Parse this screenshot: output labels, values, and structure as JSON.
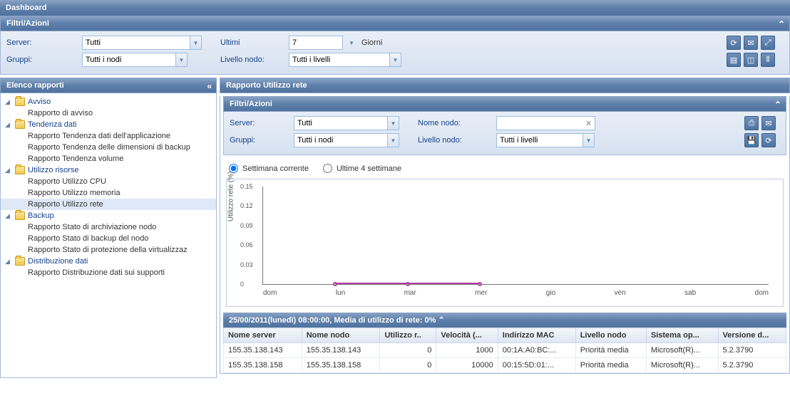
{
  "dashboard": {
    "title": "Dashboard"
  },
  "filters": {
    "title": "Filtri/Azioni",
    "server_label": "Server:",
    "server_value": "Tutti",
    "groups_label": "Gruppi:",
    "groups_value": "Tutti i nodi",
    "last_label": "Ultimi",
    "last_value": "7",
    "last_unit": "Giorni",
    "nodelevel_label": "Livello nodo:",
    "nodelevel_value": "Tutti i livelli"
  },
  "tree": {
    "title": "Elenco rapporti",
    "groups": [
      {
        "label": "Avviso",
        "items": [
          "Rapporto di avviso"
        ]
      },
      {
        "label": "Tendenza dati",
        "items": [
          "Rapporto Tendenza dati dell'applicazione",
          "Rapporto Tendenza delle dimensioni di backup",
          "Rapporto Tendenza volume"
        ]
      },
      {
        "label": "Utilizzo risorse",
        "items": [
          "Rapporto Utilizzo CPU",
          "Rapporto Utilizzo memoria",
          "Rapporto Utilizzo rete"
        ],
        "selected_index": 2
      },
      {
        "label": "Backup",
        "items": [
          "Rapporto Stato di archiviazione nodo",
          "Rapporto Stato di backup del nodo",
          "Rapporto Stato di protezione della virtualizzaz"
        ]
      },
      {
        "label": "Distribuzione dati",
        "items": [
          "Rapporto Distribuzione dati sui supporti"
        ]
      }
    ]
  },
  "report": {
    "title": "Rapporto Utilizzo rete",
    "filters_title": "Filtri/Azioni",
    "server_label": "Server:",
    "server_value": "Tutti",
    "groups_label": "Gruppi:",
    "groups_value": "Tutti i nodi",
    "nodename_label": "Nome nodo:",
    "nodename_value": "",
    "nodelevel_label": "Livello nodo:",
    "nodelevel_value": "Tutti i livelli",
    "radio_current": "Settimana corrente",
    "radio_last4": "Ultime 4 settimane"
  },
  "chart_data": {
    "type": "line",
    "ylabel": "Utilizzo rete (%)",
    "ylim": [
      0,
      0.15
    ],
    "yticks": [
      0,
      0.03,
      0.06,
      0.09,
      0.12,
      0.15
    ],
    "categories": [
      "dom",
      "lun",
      "mar",
      "mer",
      "gio",
      "ven",
      "sab",
      "dom"
    ],
    "values": [
      null,
      0,
      0,
      0,
      null,
      null,
      null,
      null
    ]
  },
  "table": {
    "title": "25/00/2011(lunedì) 08:00:00, Media di utilizzo di rete: 0%",
    "columns": [
      "Nome server",
      "Nome nodo",
      "Utilizzo r..",
      "Velocità (...",
      "Indirizzo MAC",
      "Livello nodo",
      "Sistema op...",
      "Versione d..."
    ],
    "rows": [
      [
        "155.35.138.143",
        "155.35.138.143",
        "0",
        "1000",
        "00:1A:A0:BC:...",
        "Priorità media",
        "Microsoft(R)...",
        "5.2.3790"
      ],
      [
        "155.35.138.158",
        "155.35.138.158",
        "0",
        "10000",
        "00:15:5D:01:...",
        "Priorità media",
        "Microsoft(R)...",
        "5.2.3790"
      ]
    ]
  }
}
